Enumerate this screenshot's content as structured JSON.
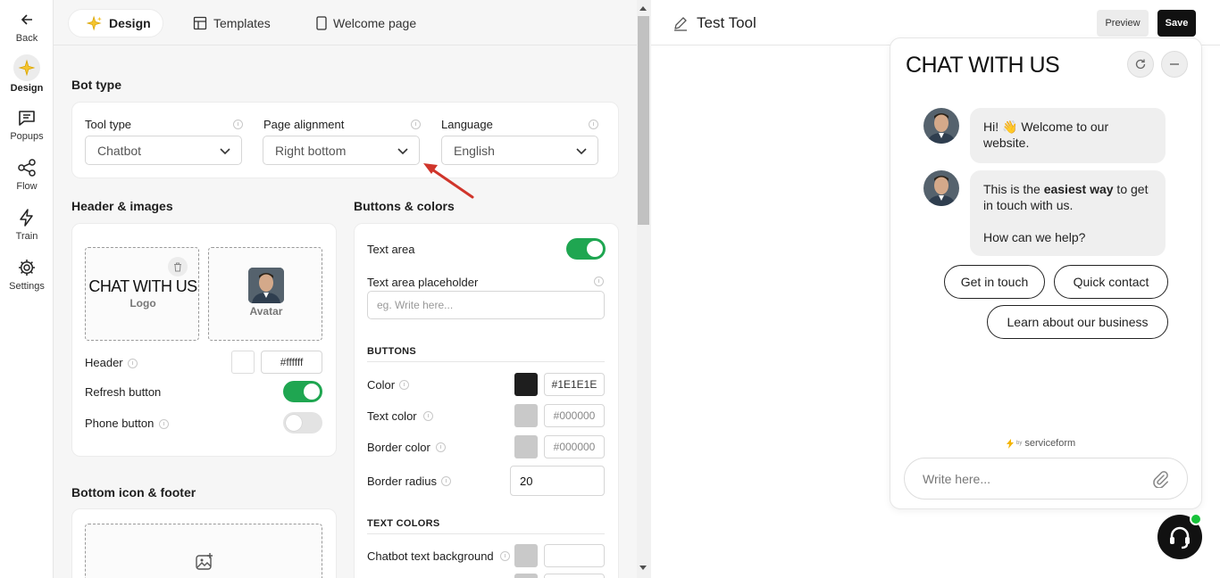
{
  "rail": {
    "back": "Back",
    "items": [
      {
        "label": "Design",
        "icon": "sparkle-icon"
      },
      {
        "label": "Popups",
        "icon": "chat-icon"
      },
      {
        "label": "Flow",
        "icon": "share-icon"
      },
      {
        "label": "Train",
        "icon": "bolt-icon"
      },
      {
        "label": "Settings",
        "icon": "gear-icon"
      }
    ]
  },
  "tabs": [
    {
      "label": "Design",
      "icon": "sparkle-icon"
    },
    {
      "label": "Templates",
      "icon": "templates-icon"
    },
    {
      "label": "Welcome page",
      "icon": "phone-icon"
    }
  ],
  "bot_type": {
    "title": "Bot type",
    "tool_type": {
      "label": "Tool type",
      "value": "Chatbot"
    },
    "page_alignment": {
      "label": "Page alignment",
      "value": "Right bottom"
    },
    "language": {
      "label": "Language",
      "value": "English"
    }
  },
  "header_images": {
    "title": "Header & images",
    "logo_text": "CHAT WITH US",
    "logo_caption": "Logo",
    "avatar_caption": "Avatar",
    "header_label": "Header",
    "header_color": "#ffffff",
    "refresh_label": "Refresh button",
    "phone_label": "Phone button"
  },
  "bottom": {
    "title": "Bottom icon & footer"
  },
  "buttons_colors": {
    "title": "Buttons & colors",
    "text_area_label": "Text area",
    "placeholder_label": "Text area placeholder",
    "placeholder_value": "eg. Write here...",
    "buttons_head": "BUTTONS",
    "color_label": "Color",
    "color_value": "#1E1E1E",
    "text_color_label": "Text color",
    "text_color_value": "#000000",
    "border_color_label": "Border color",
    "border_color_value": "#000000",
    "border_radius_label": "Border radius",
    "border_radius_value": "20",
    "text_colors_head": "TEXT COLORS",
    "chatbot_bg_label": "Chatbot text background",
    "chatbot_bg_value": ""
  },
  "preview": {
    "tool_name": "Test Tool",
    "preview_label": "Preview",
    "save_label": "Save",
    "chat_title": "CHAT WITH US",
    "msg1_pre": "Hi! ",
    "msg1_emoji": "👋",
    "msg1_post": " Welcome to our website.",
    "msg2_pre": "This is the ",
    "msg2_bold": "easiest way",
    "msg2_post": " to get in touch with us.",
    "msg2_line2": "How can we help?",
    "chips": [
      "Get in touch",
      "Quick contact",
      "Learn about our business"
    ],
    "powered_by": "by",
    "brand": "serviceform",
    "input_placeholder": "Write here..."
  },
  "colors": {
    "accent_green": "#1fa651",
    "dark": "#1E1E1E",
    "online": "#18c23a"
  }
}
